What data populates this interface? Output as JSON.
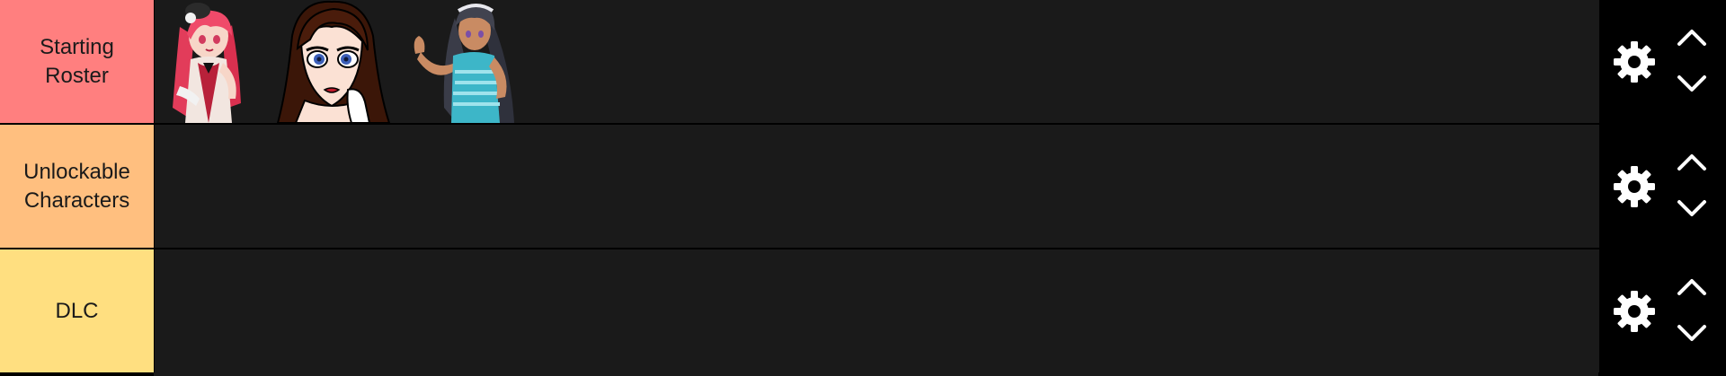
{
  "tiers": [
    {
      "label": "Starting Roster",
      "color": "#ff7f7f",
      "items": [
        {
          "icon": "anime-character-pink-hair"
        },
        {
          "icon": "anime-character-brown-hair"
        },
        {
          "icon": "anime-character-dark-hair-blue-top"
        }
      ]
    },
    {
      "label": "Unlockable Characters",
      "color": "#ffbf7f",
      "items": []
    },
    {
      "label": "DLC",
      "color": "#ffdf80",
      "items": []
    }
  ],
  "controls": {
    "settings_icon": "gear-icon",
    "move_up_icon": "chevron-up-icon",
    "move_down_icon": "chevron-down-icon"
  },
  "colors": {
    "row_background": "#1a1a1a",
    "divider": "#000000",
    "control_icon": "#ffffff"
  }
}
